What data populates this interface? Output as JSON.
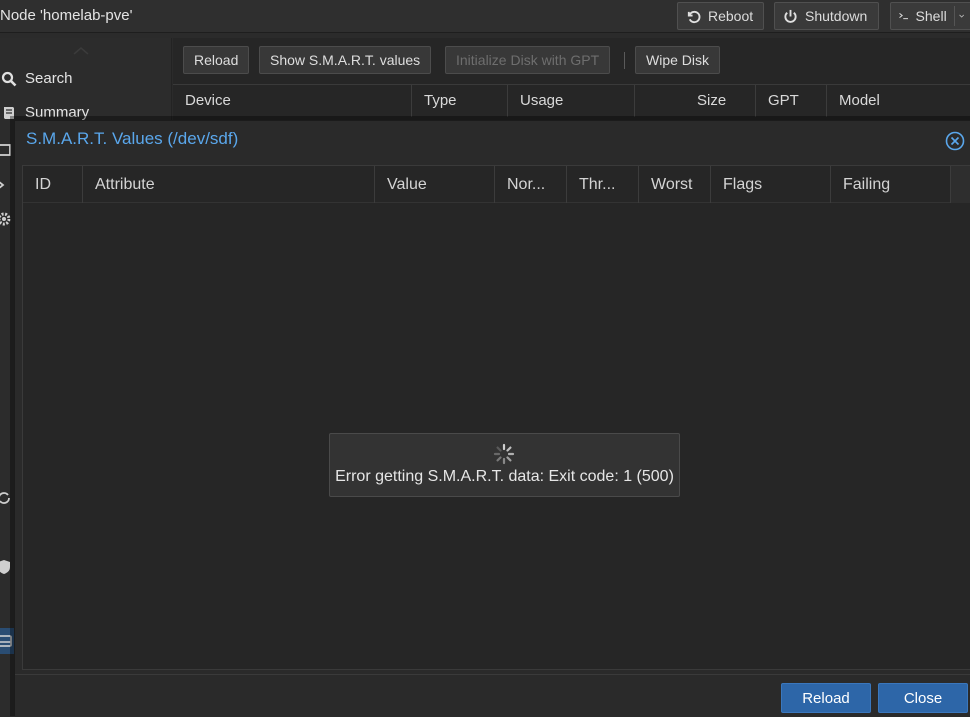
{
  "header": {
    "node_title": "Node 'homelab-pve'",
    "reboot_label": "Reboot",
    "shutdown_label": "Shutdown",
    "shell_label": "Shell"
  },
  "sidebar": {
    "search_label": "Search",
    "summary_label": "Summary"
  },
  "disks_toolbar": {
    "reload_label": "Reload",
    "smart_label": "Show S.M.A.R.T. values",
    "init_gpt_label": "Initialize Disk with GPT",
    "wipe_label": "Wipe Disk"
  },
  "disks_grid": {
    "columns": [
      "Device",
      "Type",
      "Usage",
      "Size",
      "GPT",
      "Model"
    ]
  },
  "smart_dialog": {
    "title": "S.M.A.R.T. Values (/dev/sdf)",
    "columns": [
      "ID",
      "Attribute",
      "Value",
      "Nor...",
      "Thr...",
      "Worst",
      "Flags",
      "Failing"
    ],
    "error_message": "Error getting S.M.A.R.T. data: Exit code: 1 (500)",
    "reload_label": "Reload",
    "close_label": "Close"
  },
  "colors": {
    "accent": "#5aa7ec",
    "primary_button": "#2d66a8",
    "background": "#2b2b2b"
  },
  "icons": [
    "reload-icon",
    "power-icon",
    "terminal-icon",
    "chevron-down-icon",
    "search-icon",
    "book-icon",
    "close-circle-icon",
    "spinner-icon"
  ]
}
